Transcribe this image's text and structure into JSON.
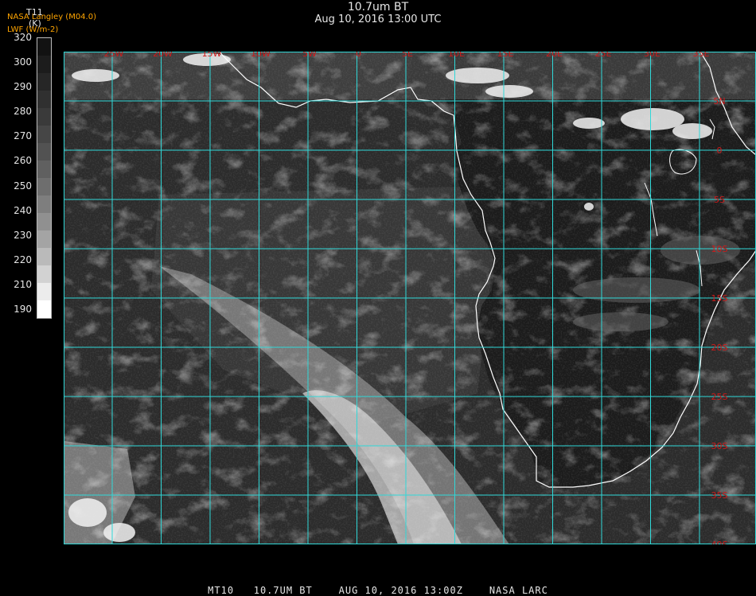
{
  "header": {
    "title": "10.7um BT",
    "subtitle": "Aug 10, 2016 13:00 UTC",
    "org_line1": "NASA Langley (M04.0)",
    "org_line2": "LWF (W/m-2)"
  },
  "legend": {
    "variable": "T11",
    "units": "(K)",
    "ticks": [
      "320",
      "300",
      "290",
      "280",
      "270",
      "260",
      "250",
      "240",
      "230",
      "220",
      "210",
      "190"
    ],
    "shades": [
      "#121212",
      "#1c1c1c",
      "#262626",
      "#303030",
      "#3a3a3a",
      "#464646",
      "#525252",
      "#606060",
      "#6e6e6e",
      "#7e7e7e",
      "#909090",
      "#a4a4a4",
      "#bababa",
      "#d2d2d2",
      "#ececec",
      "#ffffff"
    ]
  },
  "map": {
    "grid_color": "#30d8d8",
    "label_color": "#cc1a1a",
    "coast_color": "#ffffff",
    "top_labels": [
      "25W",
      "20W",
      "15W",
      "10W",
      "5W",
      "0",
      "5E",
      "10E",
      "15E",
      "20E",
      "25E",
      "30E",
      "35E"
    ],
    "right_labels": [
      "5N",
      "0",
      "5S",
      "10S",
      "15S",
      "20S",
      "25S",
      "30S",
      "35S",
      "40S"
    ]
  },
  "footer": {
    "text": "MT10   10.7UM BT    AUG 10, 2016 13:00Z    NASA LARC"
  }
}
